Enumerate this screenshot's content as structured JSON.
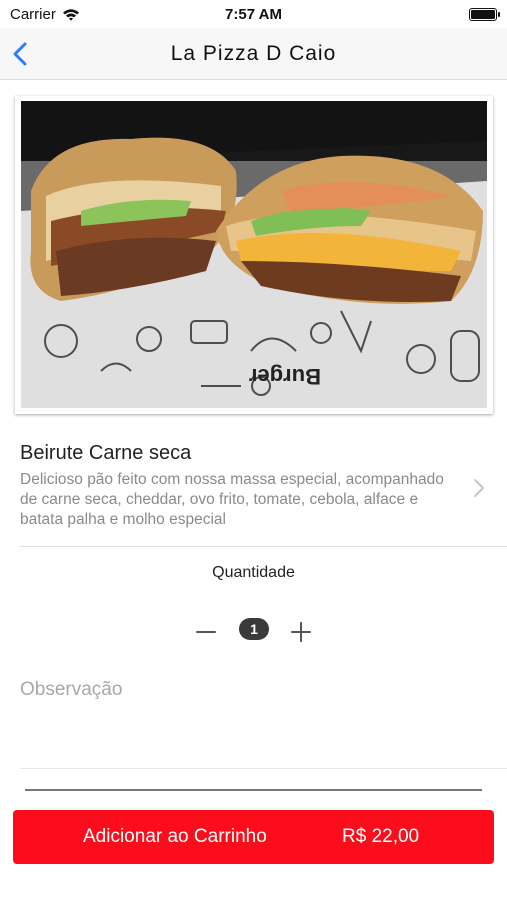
{
  "status_bar": {
    "carrier": "Carrier",
    "time": "7:57 AM"
  },
  "nav": {
    "title": "La Pizza D Caio",
    "back_icon": "chevron-left-icon"
  },
  "product": {
    "name": "Beirute Carne seca",
    "description": "Delicioso pão feito com nossa massa especial, acompanhado de carne seca, cheddar, ovo frito, tomate, cebola, alface e batata palha e molho especial"
  },
  "quantity": {
    "label": "Quantidade",
    "value": "1"
  },
  "notes": {
    "placeholder": "Observação"
  },
  "cart_button": {
    "label": "Adicionar ao Carrinho",
    "price": "R$ 22,00"
  },
  "colors": {
    "accent_blue": "#2f7cf6",
    "button_red": "#fc0d1b"
  }
}
